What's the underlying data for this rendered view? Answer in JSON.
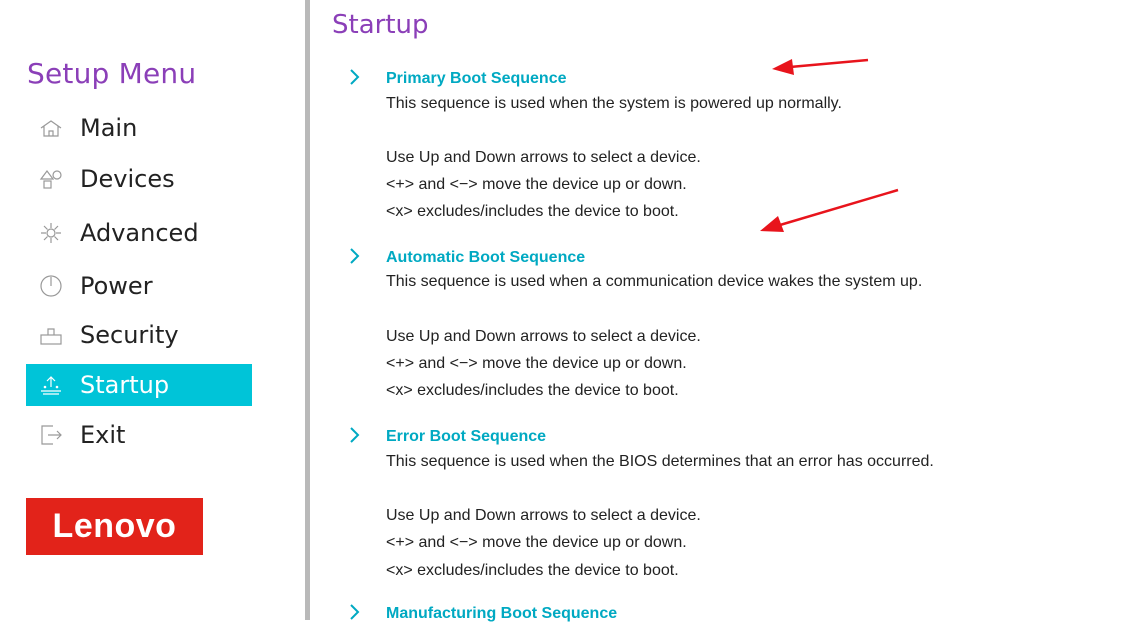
{
  "sidebar": {
    "title": "Setup Menu",
    "items": [
      {
        "label": "Main",
        "icon": "home-icon"
      },
      {
        "label": "Devices",
        "icon": "devices-icon"
      },
      {
        "label": "Advanced",
        "icon": "advanced-icon"
      },
      {
        "label": "Power",
        "icon": "power-icon"
      },
      {
        "label": "Security",
        "icon": "security-icon"
      },
      {
        "label": "Startup",
        "icon": "startup-icon",
        "active": true
      },
      {
        "label": "Exit",
        "icon": "exit-icon"
      }
    ],
    "logo": "Lenovo"
  },
  "main": {
    "title": "Startup",
    "sections": [
      {
        "heading": "Primary Boot Sequence",
        "description": "This sequence is used when the system is powered up normally.",
        "help1": "Use Up and Down arrows to select a device.",
        "help2": "<+> and <−> move the device up or down.",
        "help3": "<x> excludes/includes the device to boot."
      },
      {
        "heading": "Automatic Boot Sequence",
        "description": "This sequence is used when a communication device wakes the system up.",
        "help1": "Use Up and Down arrows to select a device.",
        "help2": "<+> and <−> move the device up or down.",
        "help3": "<x> excludes/includes the device to boot."
      },
      {
        "heading": "Error Boot Sequence",
        "description": "This sequence is used when the BIOS determines that an error has occurred.",
        "help1": "Use Up and Down arrows to select a device.",
        "help2": "<+> and <−> move the device up or down.",
        "help3": "<x> excludes/includes the device to boot."
      },
      {
        "heading": "Manufacturing Boot Sequence"
      }
    ]
  },
  "colors": {
    "accent_purple": "#8b3fb8",
    "accent_cyan": "#00c4d8",
    "heading_cyan": "#00a9c2",
    "logo_red": "#e2231a",
    "annotation_arrow": "#e8141c"
  }
}
